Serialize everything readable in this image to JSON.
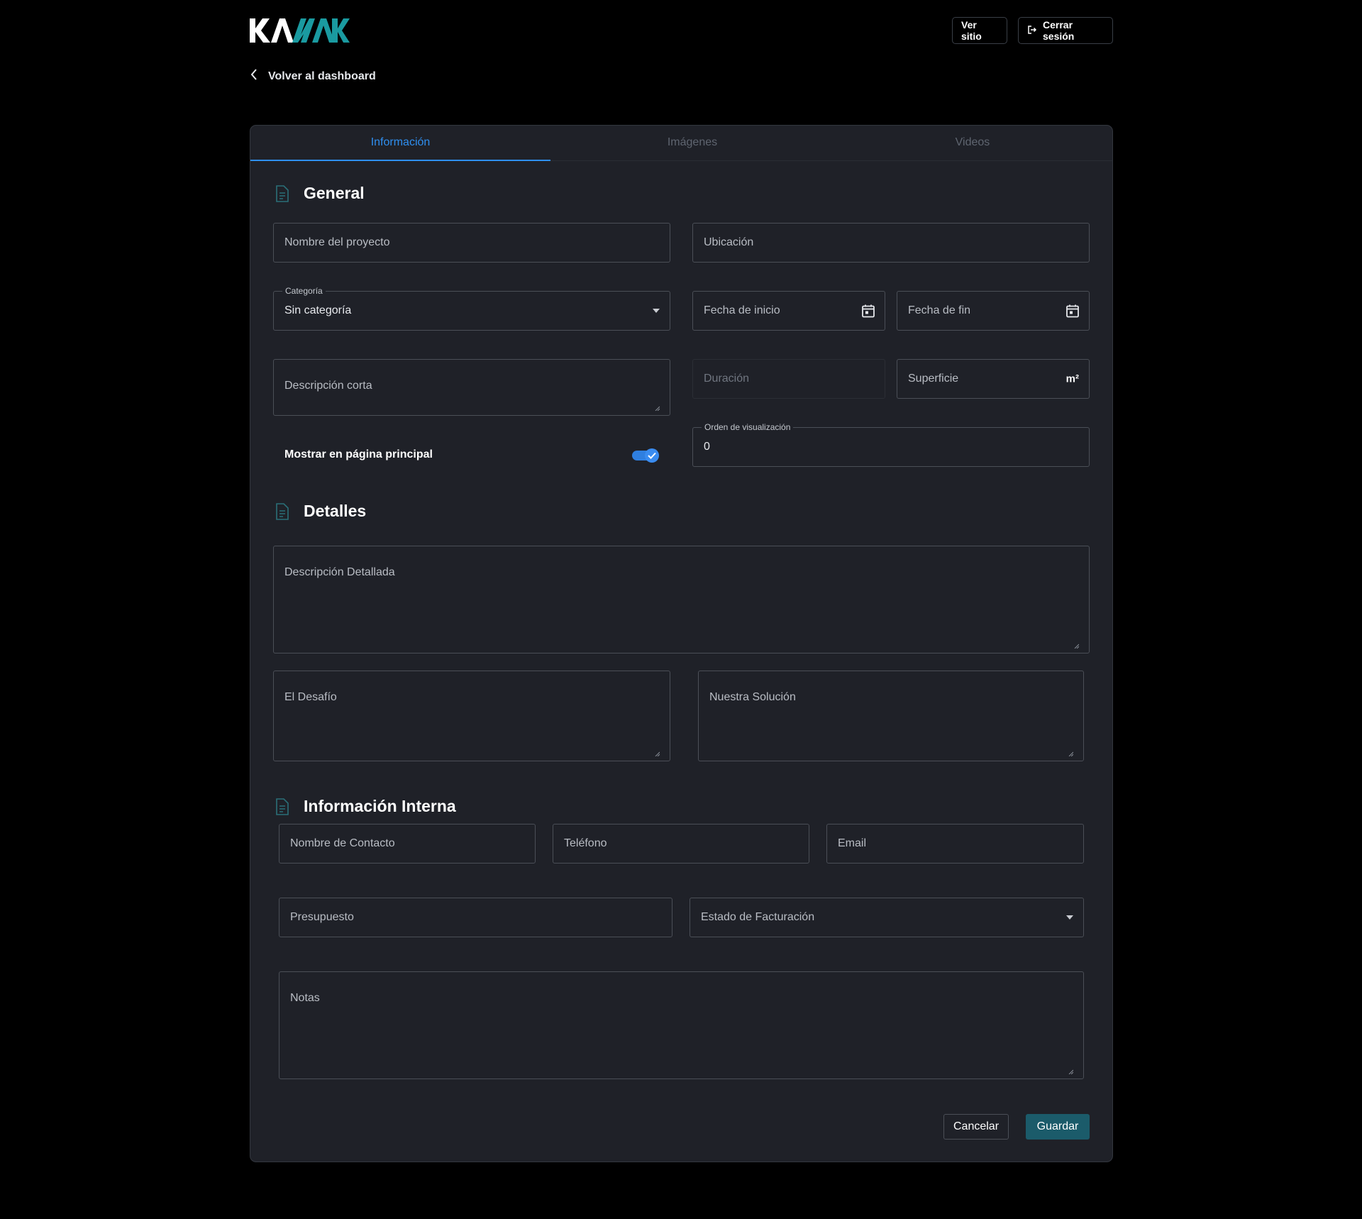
{
  "header": {
    "brand": "KAMAK",
    "view_site_label": "Ver sitio",
    "logout_label": "Cerrar sesión",
    "back_label": "Volver al dashboard"
  },
  "tabs": [
    {
      "label": "Información",
      "active": true
    },
    {
      "label": "Imágenes",
      "active": false
    },
    {
      "label": "Videos",
      "active": false
    }
  ],
  "general": {
    "title": "General",
    "project_name_placeholder": "Nombre del proyecto",
    "location_placeholder": "Ubicación",
    "category_legend": "Categoría",
    "category_value": "Sin categoría",
    "start_date_placeholder": "Fecha de inicio",
    "end_date_placeholder": "Fecha de fin",
    "short_desc_placeholder": "Descripción corta",
    "duration_placeholder": "Duración",
    "surface_placeholder": "Superficie",
    "surface_unit": "m²",
    "show_home_label": "Mostrar en página principal",
    "show_home_checked": true,
    "display_order_legend": "Orden de visualización",
    "display_order_value": "0"
  },
  "details": {
    "title": "Detalles",
    "detailed_desc_placeholder": "Descripción Detallada",
    "challenge_placeholder": "El Desafío",
    "solution_placeholder": "Nuestra Solución"
  },
  "internal": {
    "title": "Información Interna",
    "contact_name_placeholder": "Nombre de Contacto",
    "phone_placeholder": "Teléfono",
    "email_placeholder": "Email",
    "budget_placeholder": "Presupuesto",
    "billing_status_placeholder": "Estado de Facturación",
    "notes_placeholder": "Notas"
  },
  "actions": {
    "cancel_label": "Cancelar",
    "save_label": "Guardar"
  },
  "colors": {
    "accent": "#2f8ff0",
    "brand_teal": "#1a9aa0",
    "save_button": "#1b5b6a",
    "card_bg": "#1f2128"
  },
  "icons": {
    "back": "chevron-left-icon",
    "logout": "logout-icon",
    "section": "document-icon",
    "calendar": "calendar-icon",
    "dropdown": "caret-down-icon",
    "toggle_check": "check-icon"
  }
}
